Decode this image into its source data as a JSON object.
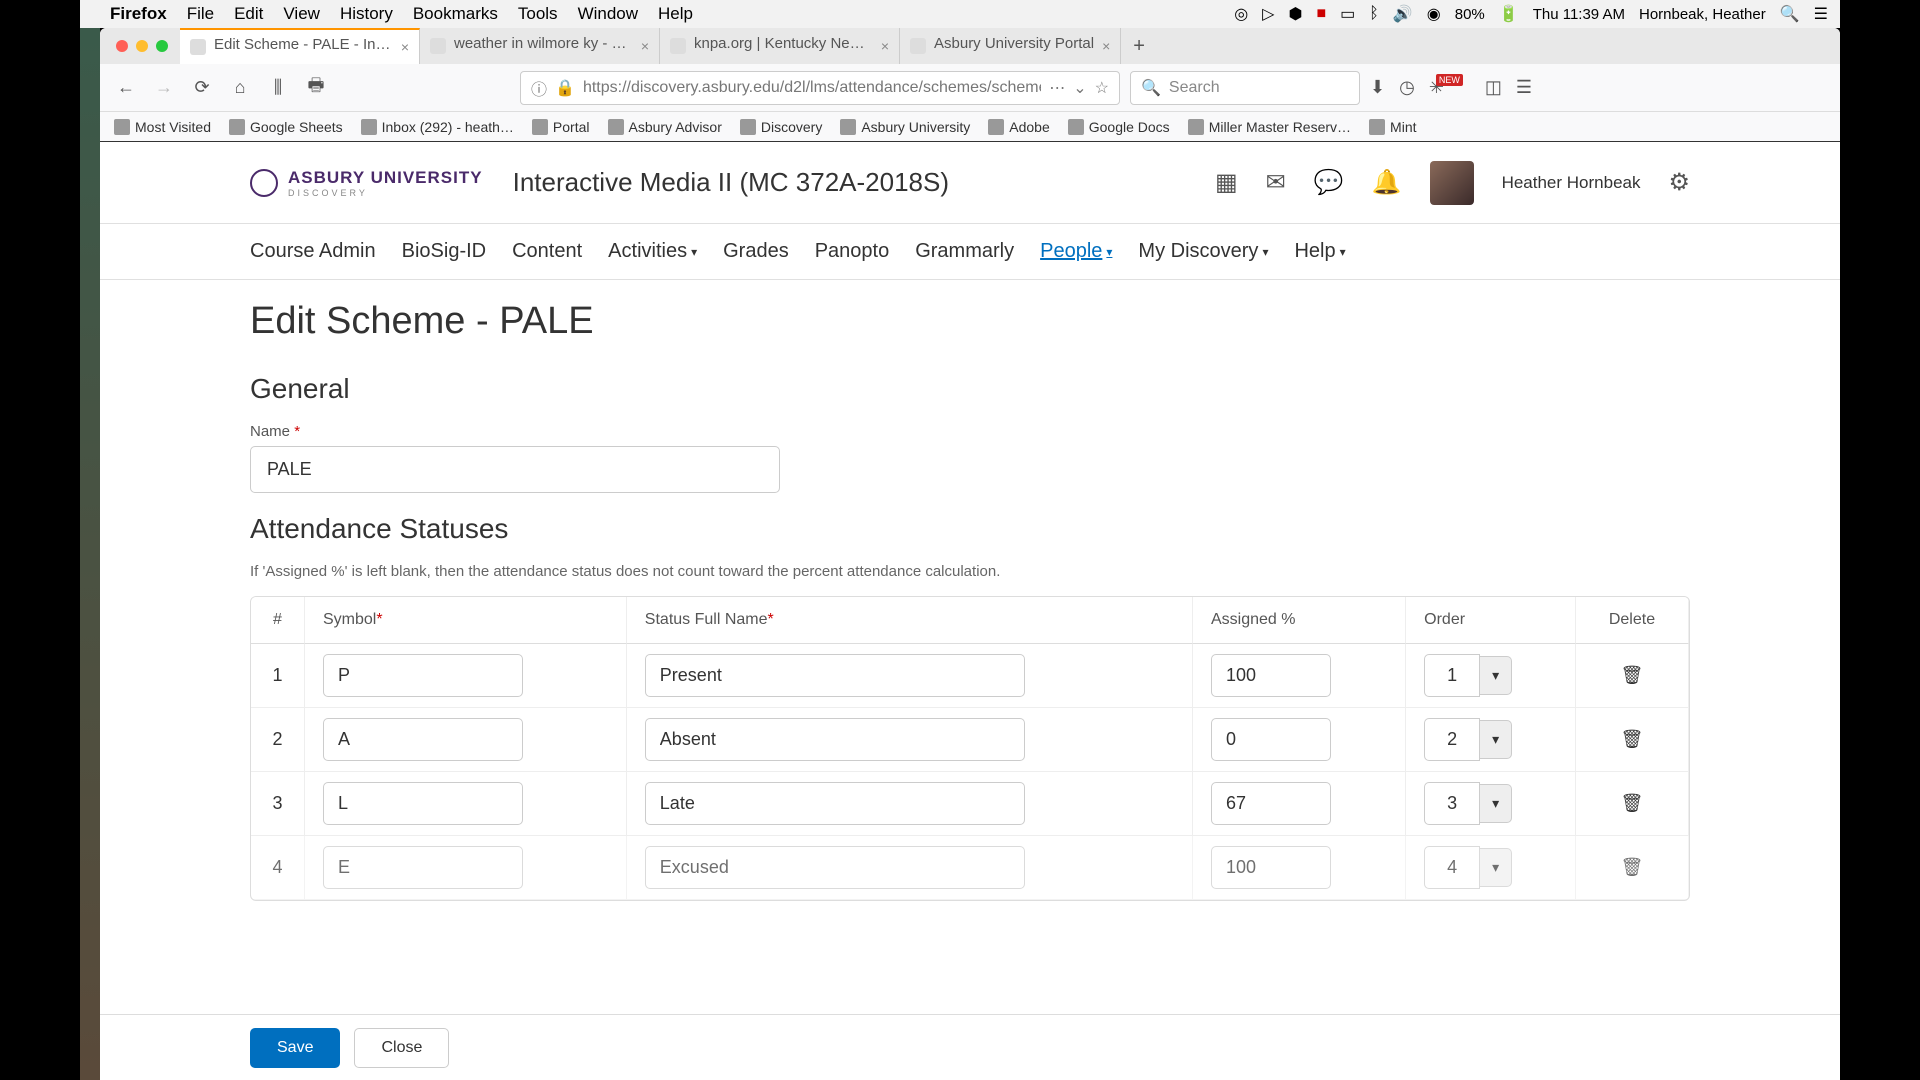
{
  "mac_menu": {
    "app": "Firefox",
    "items": [
      "File",
      "Edit",
      "View",
      "History",
      "Bookmarks",
      "Tools",
      "Window",
      "Help"
    ],
    "battery": "80%",
    "time": "Thu 11:39 AM",
    "user": "Hornbeak, Heather"
  },
  "tabs": [
    {
      "label": "Edit Scheme - PALE - Interactiv",
      "active": true
    },
    {
      "label": "weather in wilmore ky - Google"
    },
    {
      "label": "knpa.org | Kentucky News Phot"
    },
    {
      "label": "Asbury University Portal"
    }
  ],
  "url": "https://discovery.asbury.edu/d2l/lms/attendance/schemes/scheme_new",
  "search_placeholder": "Search",
  "bookmarks": [
    "Most Visited",
    "Google Sheets",
    "Inbox (292) - heath…",
    "Portal",
    "Asbury Advisor",
    "Discovery",
    "Asbury University",
    "Adobe",
    "Google Docs",
    "Miller Master Reserv…",
    "Mint"
  ],
  "brand": {
    "name": "ASBURY UNIVERSITY",
    "sub": "DISCOVERY"
  },
  "course_title": "Interactive Media II (MC 372A-2018S)",
  "profile_name": "Heather Hornbeak",
  "nav": [
    {
      "label": "Course Admin"
    },
    {
      "label": "BioSig-ID"
    },
    {
      "label": "Content"
    },
    {
      "label": "Activities",
      "dd": true
    },
    {
      "label": "Grades"
    },
    {
      "label": "Panopto"
    },
    {
      "label": "Grammarly"
    },
    {
      "label": "People",
      "dd": true,
      "active": true
    },
    {
      "label": "My Discovery",
      "dd": true
    },
    {
      "label": "Help",
      "dd": true
    }
  ],
  "page": {
    "title": "Edit Scheme - PALE",
    "general": "General",
    "name_label": "Name",
    "name_value": "PALE",
    "att_heading": "Attendance Statuses",
    "helper": "If 'Assigned %' is left blank, then the attendance status does not count toward the percent attendance calculation.",
    "cols": {
      "num": "#",
      "symbol": "Symbol",
      "fullname": "Status Full Name",
      "pct": "Assigned %",
      "order": "Order",
      "delete": "Delete"
    },
    "rows": [
      {
        "n": "1",
        "sym": "P",
        "full": "Present",
        "pct": "100",
        "order": "1"
      },
      {
        "n": "2",
        "sym": "A",
        "full": "Absent",
        "pct": "0",
        "order": "2"
      },
      {
        "n": "3",
        "sym": "L",
        "full": "Late",
        "pct": "67",
        "order": "3"
      },
      {
        "n": "4",
        "sym": "E",
        "full": "Excused",
        "pct": "100",
        "order": "4"
      }
    ],
    "save": "Save",
    "close": "Close"
  }
}
